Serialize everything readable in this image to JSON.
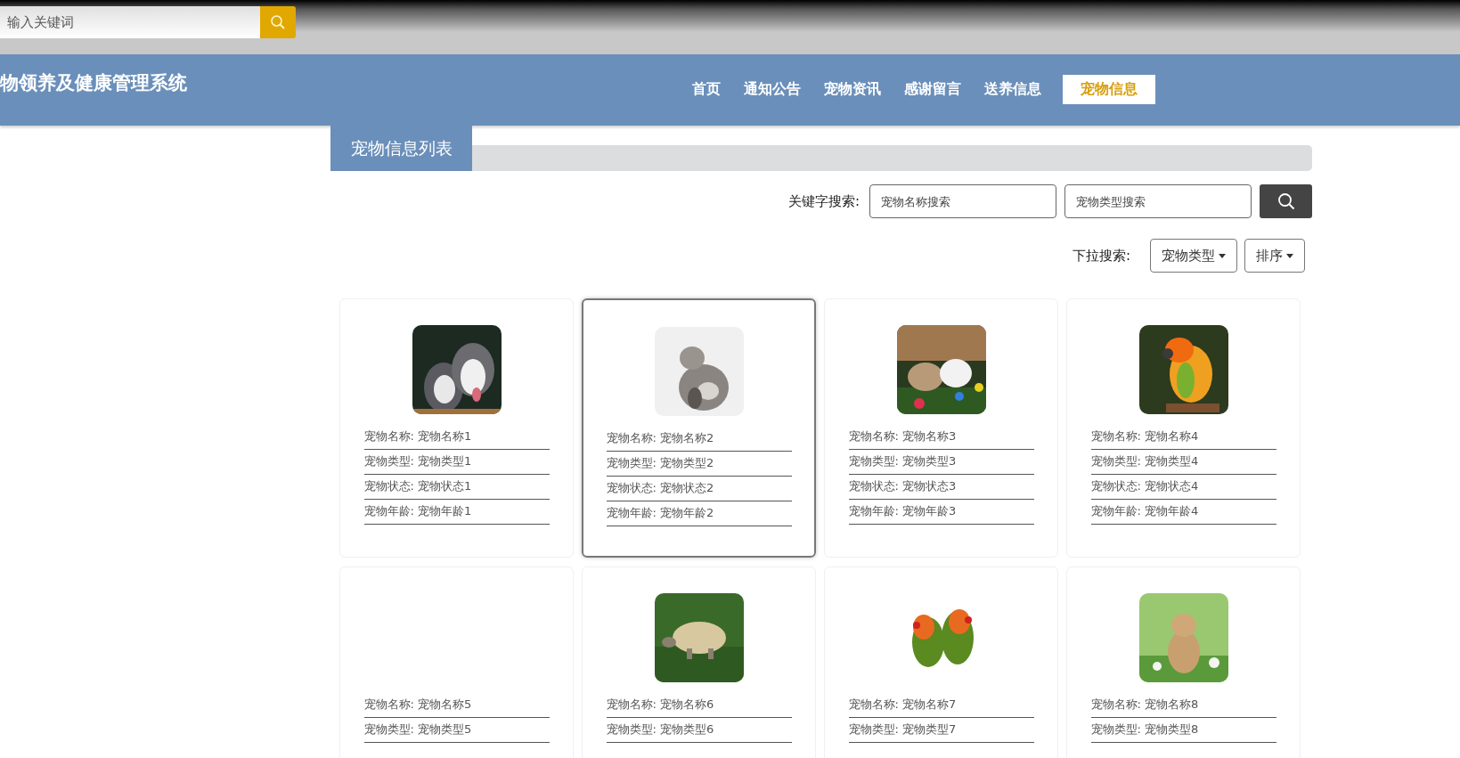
{
  "top_bar": {
    "search": {
      "placeholder": "输入关键词"
    }
  },
  "header": {
    "title": "物领养及健康管理系统",
    "nav": [
      {
        "label": "首页",
        "selected": false
      },
      {
        "label": "通知公告",
        "selected": false
      },
      {
        "label": "宠物资讯",
        "selected": false
      },
      {
        "label": "感谢留言",
        "selected": false
      },
      {
        "label": "送养信息",
        "selected": false
      },
      {
        "label": "宠物信息",
        "selected": true
      }
    ]
  },
  "section_title": "宠物信息列表",
  "keyword_search": {
    "label": "关键字搜索:",
    "fields": [
      {
        "placeholder": "宠物名称搜索"
      },
      {
        "placeholder": "宠物类型搜索"
      }
    ]
  },
  "dropdown_search": {
    "label": "下拉搜索:",
    "dropdowns": [
      "宠物类型",
      "排序"
    ]
  },
  "cards": [
    {
      "picture": true,
      "selected": false,
      "fields": [
        "宠物名称: 宠物名称1",
        "宠物类型: 宠物类型1",
        "宠物状态: 宠物状态1",
        "宠物年龄: 宠物年龄1"
      ]
    },
    {
      "picture": true,
      "selected": true,
      "fields": [
        "宠物名称: 宠物名称2",
        "宠物类型: 宠物类型2",
        "宠物状态: 宠物状态2",
        "宠物年龄: 宠物年龄2"
      ]
    },
    {
      "picture": true,
      "selected": false,
      "fields": [
        "宠物名称: 宠物名称3",
        "宠物类型: 宠物类型3",
        "宠物状态: 宠物状态3",
        "宠物年龄: 宠物年龄3"
      ]
    },
    {
      "picture": true,
      "selected": false,
      "fields": [
        "宠物名称: 宠物名称4",
        "宠物类型: 宠物类型4",
        "宠物状态: 宠物状态4",
        "宠物年龄: 宠物年龄4"
      ]
    },
    {
      "picture": false,
      "selected": false,
      "fields": [
        "宠物名称: 宠物名称5",
        "宠物类型: 宠物类型5"
      ]
    },
    {
      "picture": true,
      "selected": false,
      "fields": [
        "宠物名称: 宠物名称6",
        "宠物类型: 宠物类型6"
      ]
    },
    {
      "picture": true,
      "selected": false,
      "fields": [
        "宠物名称: 宠物名称7",
        "宠物类型: 宠物类型7"
      ]
    },
    {
      "picture": true,
      "selected": false,
      "fields": [
        "宠物名称: 宠物名称8",
        "宠物类型: 宠物类型8"
      ]
    }
  ]
}
